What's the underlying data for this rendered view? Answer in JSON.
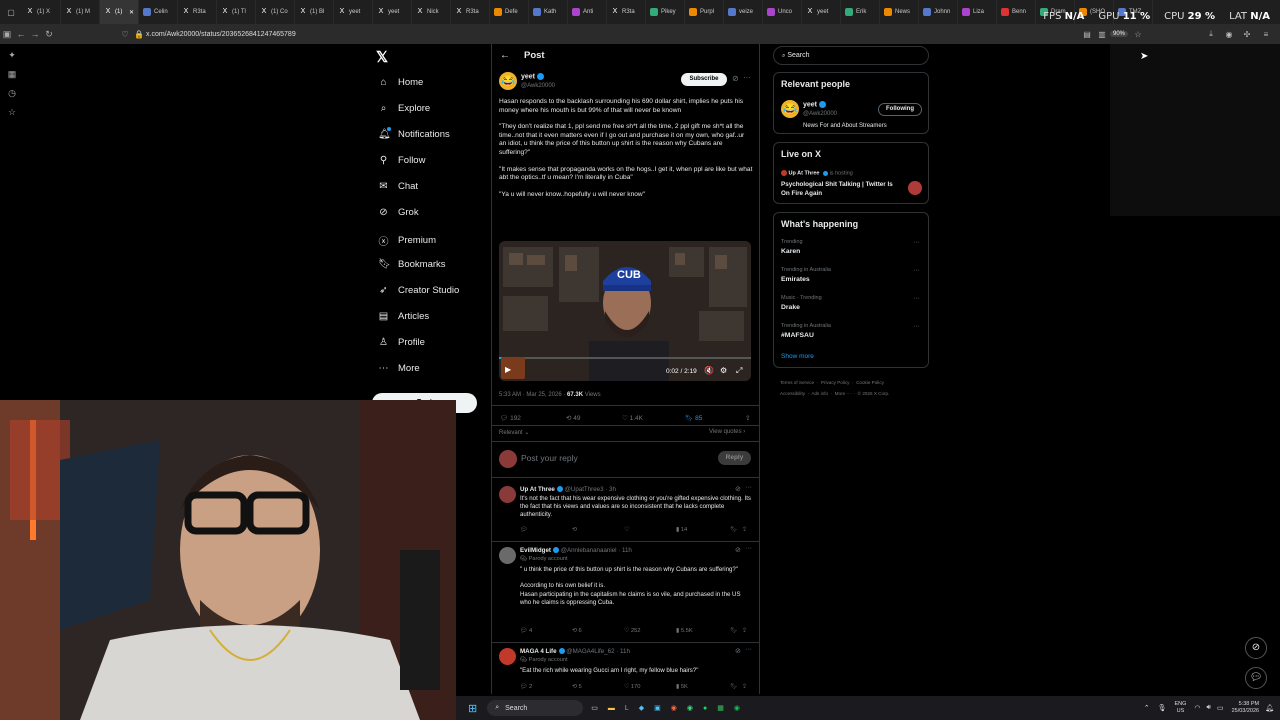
{
  "browser": {
    "tabs": [
      "(1) X",
      "(1) M",
      "(1)",
      "Celin",
      "R3ta",
      "(1) Tl",
      "(1) Co",
      "(1) Bl",
      "yeet",
      "yeet",
      "Nick",
      "R3ta",
      "Defe",
      "Kath",
      "Anti",
      "R3ta",
      "Pikey",
      "Purpl",
      "veize",
      "Unco",
      "yeet",
      "Erik",
      "News",
      "Johnn",
      "Liza",
      "Benn",
      "Dram",
      "(SHO",
      "TMZ"
    ],
    "url": "x.com/Awk20000/status/2036526841247465789",
    "zoom": "90%",
    "perf": {
      "fps_label": "FPS",
      "fps": "N/A",
      "gpu_label": "GPU",
      "gpu": "11 %",
      "cpu_label": "CPU",
      "cpu": "29 %",
      "lat_label": "LAT",
      "lat": "N/A"
    }
  },
  "nav": {
    "items": [
      {
        "label": "Home",
        "icon": "home-icon"
      },
      {
        "label": "Explore",
        "icon": "search-icon"
      },
      {
        "label": "Notifications",
        "icon": "bell-icon"
      },
      {
        "label": "Follow",
        "icon": "person-plus-icon"
      },
      {
        "label": "Chat",
        "icon": "mail-icon"
      },
      {
        "label": "Grok",
        "icon": "grok-icon"
      },
      {
        "label": "Premium",
        "icon": "x-circle-icon"
      },
      {
        "label": "Bookmarks",
        "icon": "bookmark-icon"
      },
      {
        "label": "Creator Studio",
        "icon": "rocket-icon"
      },
      {
        "label": "Articles",
        "icon": "document-icon"
      },
      {
        "label": "Profile",
        "icon": "person-icon"
      },
      {
        "label": "More",
        "icon": "more-circle-icon"
      }
    ],
    "post_button": "Post"
  },
  "post": {
    "header": "Post",
    "author_name": "yeet",
    "author_handle": "@Awk20000",
    "subscribe": "Subscribe",
    "paragraphs": [
      "Hasan responds to the backlash surrounding his 690 dollar shirt, implies he puts his money where his mouth is but 99% of that will never be known",
      "\"They don't realize that 1, ppl send me free sh*t all the time, 2 ppl gift me sh*t all the time..not that it even matters even if I go out and purchase it on my own, who gaf..ur an idiot, u think the price of this button up shirt is the reason why Cubans are suffering?\"",
      "\"It makes sense that propaganda works on the hogs..I get it, when ppl are like but what abt the optics..tf u mean? I'm literally in Cuba\"",
      "\"Ya u will never know..hopefully u will never know\""
    ],
    "video_time": "0:02 / 2:19",
    "timestamp": "5:33 AM · Mar 25, 2026 · ",
    "views": "67.3K",
    "views_label": " Views",
    "replies": "192",
    "reposts": "49",
    "likes": "1.4K",
    "bookmarks": "85",
    "relevant": "Relevant",
    "view_quotes": "View quotes",
    "reply_placeholder": "Post your reply",
    "reply_button": "Reply"
  },
  "replies": [
    {
      "name": "Up At Three",
      "handle": "@UpatThree3 · 3h",
      "parody": "",
      "text": "It's not the fact that his wear expensive clothing or you're gifted expensive clothing. Its the fact that his views and values are so inconsistent that he lacks complete authenticity.",
      "reposts": "",
      "likes": "",
      "views": "14"
    },
    {
      "name": "EvilMidget",
      "handle": "@Annlebananaaniel · 11h",
      "parody": "Parody account",
      "text": "\" u think the price of this button up shirt is the reason why Cubans are suffering?\"\n\nAccording to his own belief it is.\nHasan participating in the capitalism he claims is so vile, and purchased in the US who he claims is oppressing Cuba.",
      "replies": "4",
      "reposts": "6",
      "likes": "252",
      "views": "5.5K"
    },
    {
      "name": "MAGA 4 Life",
      "handle": "@MAGA4Life_62 · 11h",
      "parody": "Parody account",
      "text": "\"Eat the rich while wearing Gucci am I right, my fellow blue hairs?\"",
      "replies": "2",
      "reposts": "5",
      "likes": "170",
      "views": "5K"
    }
  ],
  "right": {
    "search_placeholder": "Search",
    "relevant_people": "Relevant people",
    "person_name": "yeet",
    "person_handle": "@Awk20000",
    "person_bio": "News For and About Streamers",
    "following": "Following",
    "live_title": "Live on X",
    "live_host": "Up At Three",
    "live_status": "is hosting",
    "live_text": "Psychological Shit Talking | Twitter Is On Fire Again",
    "happening_title": "What's happening",
    "trends": [
      {
        "label": "Trending",
        "topic": "Karen"
      },
      {
        "label": "Trending in Australia",
        "topic": "Emirates"
      },
      {
        "label": "Music · Trending",
        "topic": "Drake"
      },
      {
        "label": "Trending in Australia",
        "topic": "#MAFSAU"
      }
    ],
    "show_more": "Show more",
    "footer": [
      "Terms of Service",
      "Privacy Policy",
      "Cookie Policy",
      "Accessibility",
      "Ads info",
      "More ···",
      "© 2026 X Corp."
    ]
  },
  "taskbar": {
    "search": "Search",
    "lang": "ENG",
    "region": "US",
    "time": "5:38 PM",
    "date": "25/03/2026"
  },
  "colors": {
    "accent": "#1d9bf0",
    "bg": "#000000",
    "border": "#2f3336",
    "muted": "#71767b"
  }
}
